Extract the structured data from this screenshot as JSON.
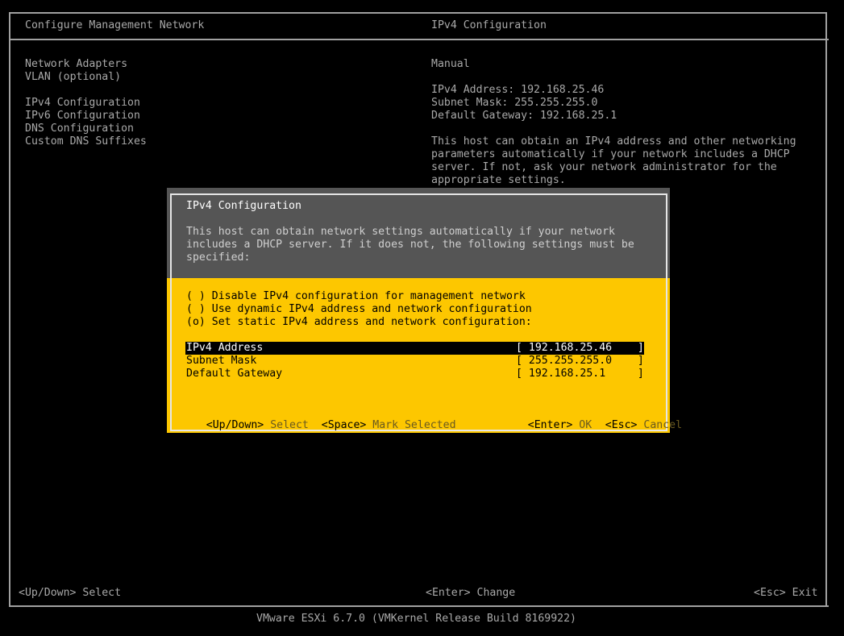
{
  "header": {
    "left_title": "Configure Management Network",
    "right_title": "IPv4 Configuration"
  },
  "menu": {
    "items": [
      "Network Adapters",
      "VLAN (optional)",
      "IPv4 Configuration",
      "IPv6 Configuration",
      "DNS Configuration",
      "Custom DNS Suffixes"
    ]
  },
  "info": {
    "mode": "Manual",
    "ipv4_address": "IPv4 Address: 192.168.25.46",
    "subnet_mask": "Subnet Mask: 255.255.255.0",
    "default_gateway": "Default Gateway: 192.168.25.1",
    "desc_lines": [
      "This host can obtain an IPv4 address and other networking",
      "parameters automatically if your network includes a DHCP",
      "server. If not, ask your network administrator for the",
      "appropriate settings."
    ]
  },
  "dialog": {
    "title": "IPv4 Configuration",
    "desc_lines": [
      "This host can obtain network settings automatically if your network",
      "includes a DHCP server. If it does not, the following settings must be",
      "specified:"
    ],
    "options": [
      "( ) Disable IPv4 configuration for management network",
      "( ) Use dynamic IPv4 address and network configuration",
      "(o) Set static IPv4 address and network configuration:"
    ],
    "fields": [
      {
        "label": "IPv4 Address",
        "value": "[ 192.168.25.46    ]"
      },
      {
        "label": "Subnet Mask",
        "value": "[ 255.255.255.0    ]"
      },
      {
        "label": "Default Gateway",
        "value": "[ 192.168.25.1     ]"
      }
    ],
    "keys": {
      "updown_key": "<Up/Down>",
      "updown_label": "Select",
      "space_key": "<Space>",
      "space_label": "Mark Selected",
      "enter_key": "<Enter>",
      "enter_label": "OK",
      "esc_key": "<Esc>",
      "esc_label": "Cancel"
    }
  },
  "bottom_keys": {
    "updown": "<Up/Down> Select",
    "enter": "<Enter> Change",
    "esc": "<Esc> Exit"
  },
  "footer": {
    "version": "VMware ESXi 6.7.0 (VMKernel Release Build 8169922)"
  },
  "colors": {
    "background": "#000000",
    "dialog_yellow": "#fdc700",
    "dialog_gray": "#555555"
  }
}
